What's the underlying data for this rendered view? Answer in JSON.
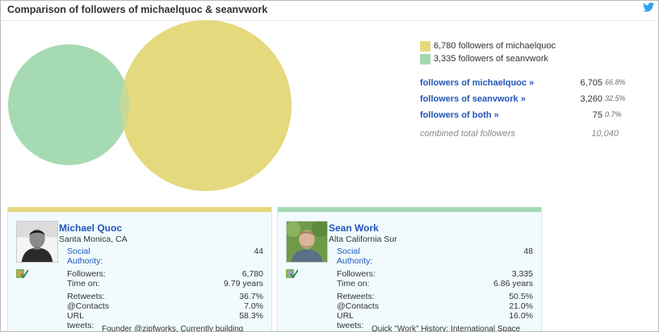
{
  "header": {
    "title": "Comparison of followers of michaelquoc & seanvwork",
    "icon": "twitter-bird-icon"
  },
  "colors": {
    "michael": "#e5d97e",
    "sean": "#a3d9b1",
    "link": "#2255bb"
  },
  "legend": {
    "michael": "6,780 followers of michaelquoc",
    "sean": "3,335 followers of seanvwork"
  },
  "stats": {
    "rows": [
      {
        "label": "followers of michaelquoc »",
        "value": "6,705",
        "pct": "66.8%"
      },
      {
        "label": "followers of seanvwork »",
        "value": "3,260",
        "pct": "32.5%"
      },
      {
        "label": "followers of both »",
        "value": "75",
        "pct": "0.7%"
      }
    ],
    "total_label": "combined total followers",
    "total_value": "10,040"
  },
  "venn": {
    "michael_followers": 6780,
    "sean_followers": 3335,
    "overlap": 75
  },
  "cards": [
    {
      "name": "Michael Quoc",
      "location": "Santa Monica, CA",
      "social_label": "Social",
      "authority_label": "Authority:",
      "social_authority": "44",
      "followers_label": "Followers:",
      "followers": "6,780",
      "time_label": "Time on:",
      "time_on": "9.79 years",
      "retweets_label": "Retweets:",
      "retweets": "36.7%",
      "contacts_label": "@Contacts",
      "contacts": "7.0%",
      "url_label": "URL",
      "url": "58.3%",
      "tweets_label": "tweets:",
      "bio": "Founder @zipfworks. Currently building"
    },
    {
      "name": "Sean Work",
      "location": "Alta California Sur",
      "social_label": "Social",
      "authority_label": "Authority:",
      "social_authority": "48",
      "followers_label": "Followers:",
      "followers": "3,335",
      "time_label": "Time on:",
      "time_on": "6.86 years",
      "retweets_label": "Retweets:",
      "retweets": "50.5%",
      "contacts_label": "@Contacts",
      "contacts": "21.0%",
      "url_label": "URL",
      "url": "16.0%",
      "tweets_label": "tweets:",
      "bio": "Quick \"Work\" History: International Space"
    }
  ]
}
